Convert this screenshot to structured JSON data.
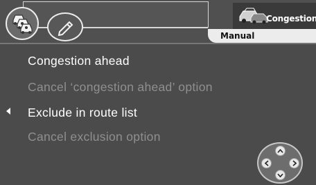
{
  "header": {
    "title_value": "",
    "mode_label": "Congestion",
    "submode_label": "Manual",
    "icons": {
      "traffic": "traffic-jam-icon",
      "edit": "pencil-icon",
      "mode": "car-congestion-icon"
    }
  },
  "menu": {
    "items": [
      {
        "label": "Congestion ahead",
        "state": "enabled"
      },
      {
        "label": "Cancel ‘congestion ahead’ option",
        "state": "disabled"
      },
      {
        "label": "Exclude in route list",
        "state": "enabled"
      },
      {
        "label": "Cancel exclusion option",
        "state": "disabled"
      }
    ]
  },
  "colors": {
    "background": "#4b4b4b",
    "enabled_text": "#ffffff",
    "disabled_text": "#8f8f8f",
    "tab": "#ececec"
  }
}
